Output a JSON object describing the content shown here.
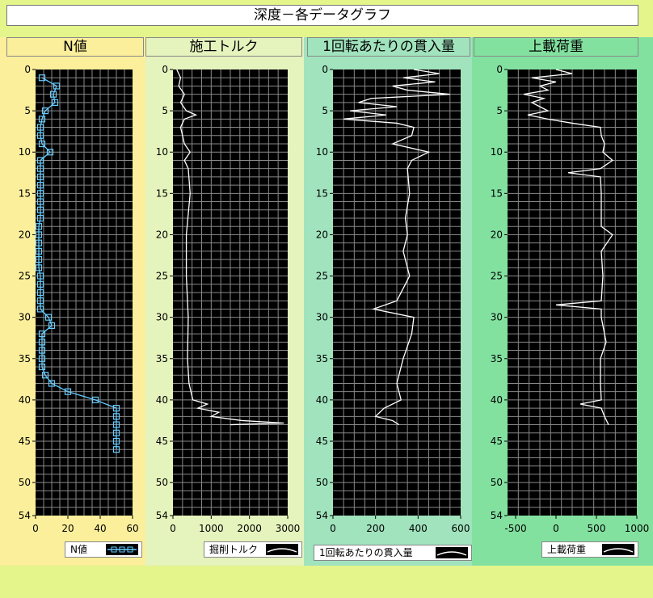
{
  "window_title": "深度－各データグラフ",
  "colors": {
    "background": "#e3f58b",
    "plot_bg": "#000000",
    "grid": "#888888",
    "n_series": "#66ccff",
    "trace": "#ffffff",
    "panel1": "#fbef9b",
    "panel2": "#e5f3bd",
    "panel3": "#a0e3bd",
    "panel4": "#83e1a0"
  },
  "chart_data": [
    {
      "type": "line",
      "title": "N値",
      "ylim": [
        54,
        0
      ],
      "xlim": [
        0,
        60
      ],
      "xticks": [
        "0",
        "20",
        "40",
        "60"
      ],
      "yticks": [
        "0",
        "5",
        "10",
        "15",
        "20",
        "25",
        "30",
        "35",
        "40",
        "45",
        "50",
        "54"
      ],
      "legend": "N値",
      "grid": true,
      "series": [
        {
          "marker": "square",
          "depth": [
            1,
            2,
            3,
            4,
            5,
            6,
            7,
            8,
            9,
            10,
            11,
            12,
            13,
            14,
            15,
            16,
            17,
            18,
            19,
            20,
            21,
            22,
            23,
            24,
            25,
            26,
            27,
            28,
            29,
            30,
            31,
            32,
            33,
            34,
            35,
            36,
            37,
            38,
            39,
            40,
            41,
            42,
            43,
            44,
            45,
            46
          ],
          "values": [
            4,
            13,
            11,
            12,
            6,
            4,
            3,
            3,
            4,
            9,
            3,
            3,
            3,
            3,
            3,
            3,
            3,
            3,
            2,
            2,
            2,
            2,
            2,
            2,
            3,
            3,
            3,
            3,
            3,
            8,
            10,
            4,
            4,
            4,
            4,
            4,
            6,
            10,
            20,
            37,
            50,
            50,
            50,
            50,
            50,
            50
          ]
        }
      ]
    },
    {
      "type": "line",
      "title": "施工トルク",
      "ylim": [
        54,
        0
      ],
      "xlim": [
        0,
        3000
      ],
      "xticks": [
        "0",
        "1000",
        "2000",
        "3000"
      ],
      "yticks": [
        "0",
        "5",
        "10",
        "15",
        "20",
        "25",
        "30",
        "35",
        "40",
        "45",
        "50",
        "54"
      ],
      "legend": "掘削トルク",
      "grid": true,
      "series": [
        {
          "depth": [
            0,
            1,
            2,
            3,
            4,
            5,
            5.5,
            6,
            7,
            8,
            9,
            10,
            11,
            12,
            15,
            20,
            25,
            30,
            35,
            38,
            39,
            40,
            40.5,
            41,
            41.5,
            42,
            42.5,
            42.8,
            43
          ],
          "values": [
            100,
            200,
            150,
            300,
            200,
            350,
            600,
            300,
            200,
            250,
            300,
            450,
            300,
            400,
            450,
            350,
            350,
            400,
            380,
            420,
            470,
            520,
            900,
            650,
            1200,
            1000,
            1800,
            2900,
            1500
          ]
        }
      ]
    },
    {
      "type": "line",
      "title": "1回転あたりの貫入量",
      "ylim": [
        54,
        0
      ],
      "xlim": [
        0,
        600
      ],
      "xticks": [
        "0",
        "200",
        "400",
        "600"
      ],
      "yticks": [
        "0",
        "5",
        "10",
        "15",
        "20",
        "25",
        "30",
        "35",
        "40",
        "45",
        "50",
        "54"
      ],
      "legend": "1回転あたりの貫入量",
      "grid": true,
      "series": [
        {
          "depth": [
            0,
            0.5,
            1,
            1.5,
            2,
            2.5,
            3,
            3.5,
            4,
            4.5,
            5,
            5.5,
            6,
            6.5,
            7,
            8,
            9,
            10,
            11,
            12,
            15,
            18,
            20,
            22,
            25,
            28,
            29,
            30,
            32,
            35,
            38,
            40,
            41,
            42,
            42.5,
            43
          ],
          "values": [
            380,
            500,
            330,
            480,
            280,
            350,
            550,
            180,
            120,
            300,
            80,
            250,
            50,
            300,
            380,
            370,
            280,
            450,
            370,
            350,
            360,
            340,
            350,
            330,
            360,
            300,
            190,
            380,
            370,
            330,
            300,
            320,
            240,
            200,
            280,
            310
          ]
        }
      ]
    },
    {
      "type": "line",
      "title": "上載荷重",
      "ylim": [
        54,
        0
      ],
      "xlim": [
        -600,
        1000
      ],
      "xticks": [
        "-500",
        "0",
        "500",
        "1000"
      ],
      "yticks": [
        "0",
        "5",
        "10",
        "15",
        "20",
        "25",
        "30",
        "35",
        "40",
        "45",
        "50",
        "54"
      ],
      "legend": "上載荷重",
      "grid": true,
      "series": [
        {
          "depth": [
            0,
            0.5,
            1,
            1.5,
            2,
            2.5,
            3,
            3.5,
            4,
            4.5,
            5,
            5.5,
            6,
            6.5,
            7,
            8,
            9,
            10,
            11,
            12,
            12.5,
            13,
            15,
            19,
            20,
            22,
            25,
            28,
            28.5,
            29,
            30,
            33,
            35,
            38,
            40,
            40.5,
            41,
            42,
            43
          ],
          "values": [
            0,
            200,
            -300,
            0,
            -200,
            -100,
            -400,
            -150,
            -300,
            -200,
            -100,
            -350,
            -100,
            200,
            550,
            560,
            600,
            580,
            700,
            550,
            150,
            550,
            560,
            560,
            700,
            560,
            580,
            560,
            0,
            560,
            560,
            620,
            550,
            550,
            560,
            300,
            560,
            600,
            650
          ]
        }
      ]
    }
  ]
}
